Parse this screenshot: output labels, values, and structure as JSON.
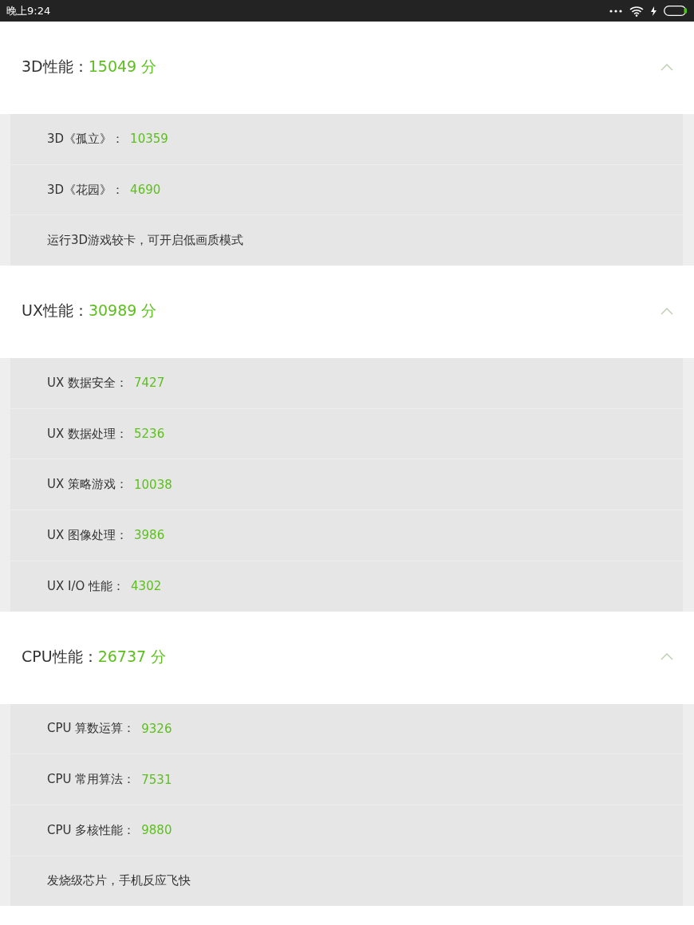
{
  "status_bar": {
    "time": "晚上9:24"
  },
  "sections": [
    {
      "label": "3D性能：",
      "score": "15049 分",
      "expanded": true,
      "items": [
        {
          "kind": "score",
          "label": "3D《孤立》：",
          "value": "10359"
        },
        {
          "kind": "score",
          "label": "3D《花园》：",
          "value": "4690"
        },
        {
          "kind": "note",
          "text": "运行3D游戏较卡，可开启低画质模式"
        }
      ]
    },
    {
      "label": "UX性能：",
      "score": "30989 分",
      "expanded": true,
      "items": [
        {
          "kind": "score",
          "label": "UX 数据安全：",
          "value": "7427"
        },
        {
          "kind": "score",
          "label": "UX 数据处理：",
          "value": "5236"
        },
        {
          "kind": "score",
          "label": "UX 策略游戏：",
          "value": "10038"
        },
        {
          "kind": "score",
          "label": "UX 图像处理：",
          "value": "3986"
        },
        {
          "kind": "score",
          "label": "UX I/O 性能：",
          "value": "4302"
        }
      ]
    },
    {
      "label": "CPU性能：",
      "score": "26737 分",
      "expanded": true,
      "items": [
        {
          "kind": "score",
          "label": "CPU 算数运算：",
          "value": "9326"
        },
        {
          "kind": "score",
          "label": "CPU 常用算法：",
          "value": "7531"
        },
        {
          "kind": "score",
          "label": "CPU 多核性能：",
          "value": "9880"
        },
        {
          "kind": "note",
          "text": "发烧级芯片，手机反应飞快"
        }
      ]
    }
  ]
}
